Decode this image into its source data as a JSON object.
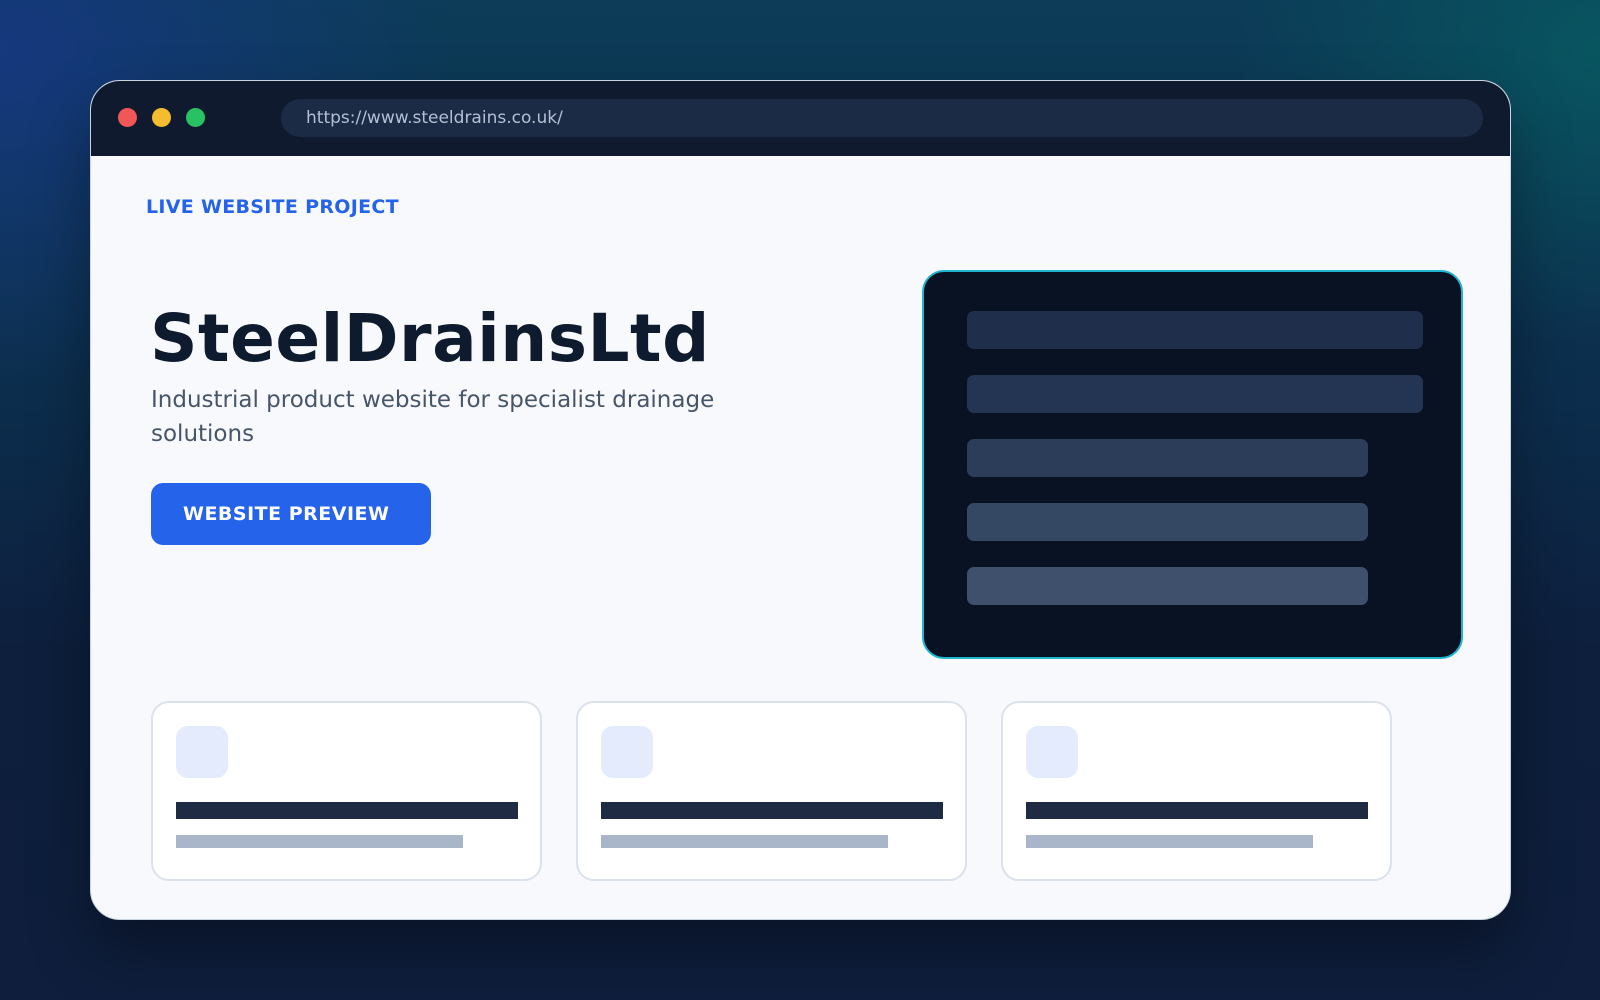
{
  "browser": {
    "url": "https://www.steeldrains.co.uk/",
    "controls": [
      "close",
      "minimize",
      "maximize"
    ]
  },
  "hero": {
    "kicker": "LIVE WEBSITE PROJECT",
    "title": "SteelDrainsLtd",
    "subtitle": "Industrial product website for specialist drainage solutions",
    "cta_label": "WEBSITE PREVIEW"
  },
  "colors": {
    "accent": "#2563eb",
    "panel_border": "#1fb5d0",
    "panel_bg": "#081223",
    "close_dot": "#f25757",
    "minimize_dot": "#f4bc2f",
    "maximize_dot": "#28c262"
  }
}
